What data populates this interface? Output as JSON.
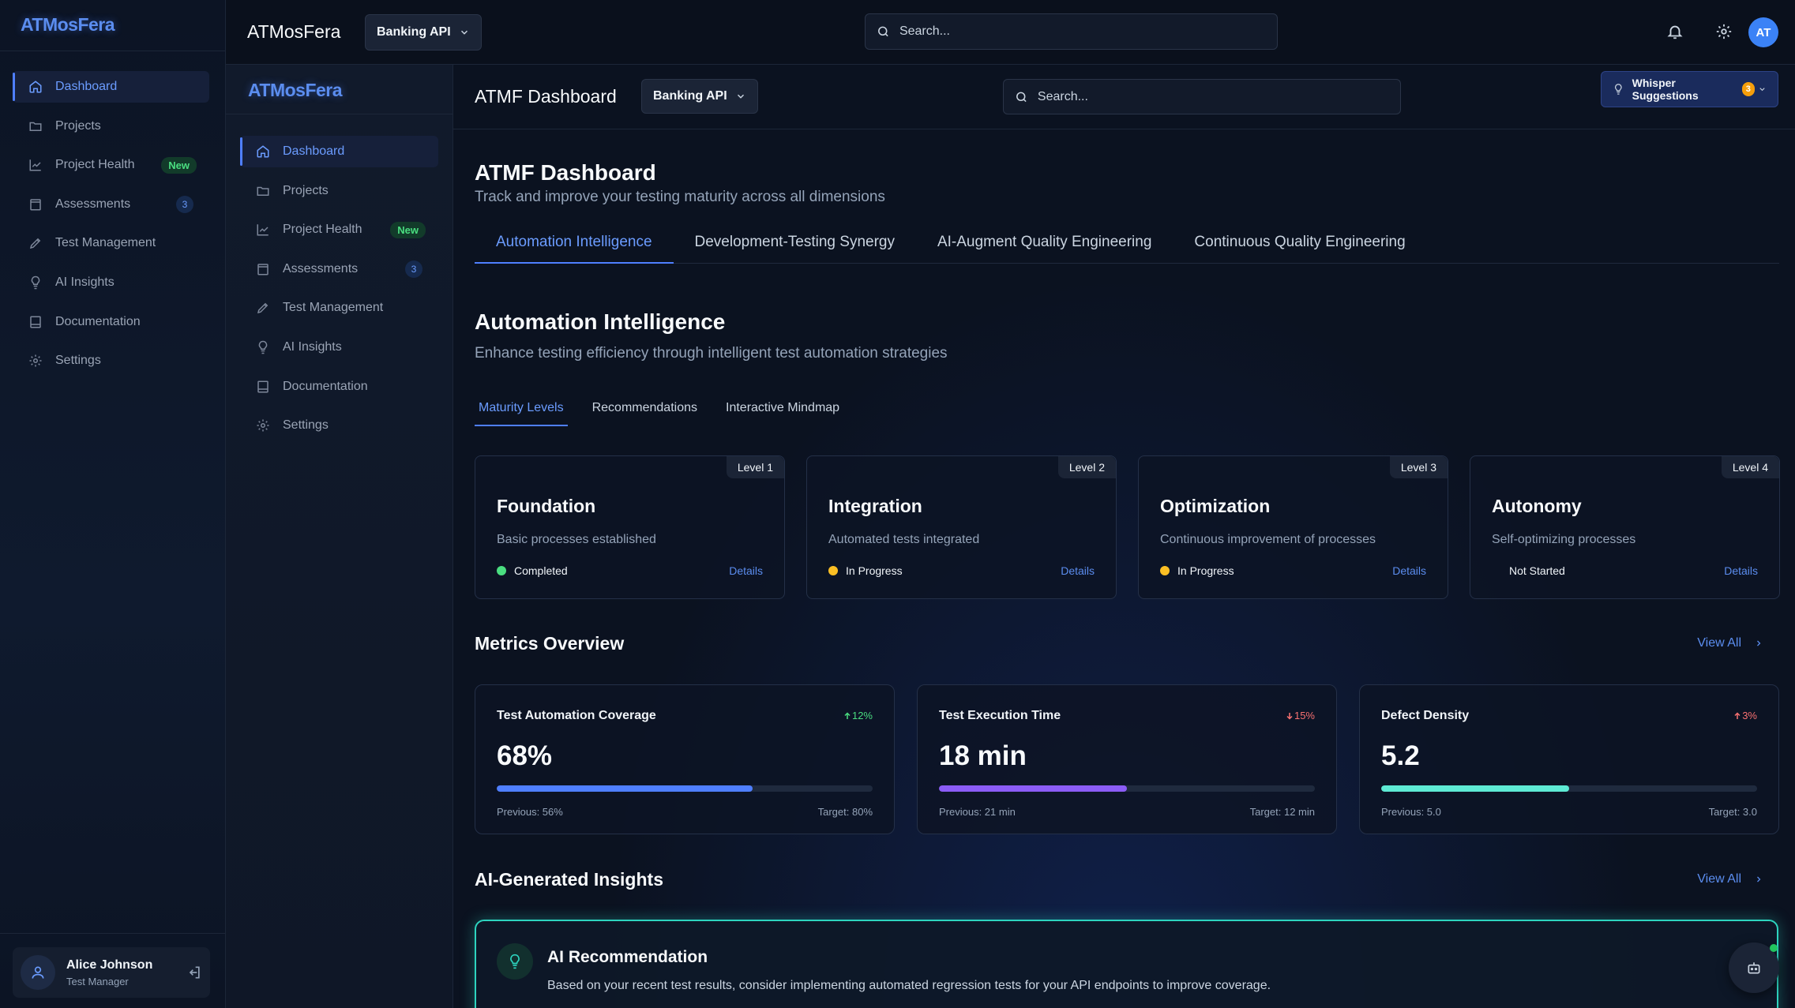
{
  "brand": {
    "logo_text": "ATMosFera",
    "accent": "#5b8def"
  },
  "sidebar": {
    "items": [
      {
        "label": "Dashboard",
        "icon": "home-icon",
        "active": true
      },
      {
        "label": "Projects",
        "icon": "folder-icon"
      },
      {
        "label": "Project Health",
        "icon": "chart-line-icon",
        "badge": "New"
      },
      {
        "label": "Assessments",
        "icon": "clipboard-icon",
        "count": "3"
      },
      {
        "label": "Test Management",
        "icon": "pencil-icon"
      },
      {
        "label": "AI Insights",
        "icon": "lightbulb-icon"
      },
      {
        "label": "Documentation",
        "icon": "book-icon"
      },
      {
        "label": "Settings",
        "icon": "gear-icon"
      }
    ]
  },
  "user": {
    "name": "Alice Johnson",
    "role": "Test Manager"
  },
  "topbar": {
    "app_title": "ATMosFera",
    "project": "Banking API",
    "search_placeholder": "Search...",
    "avatar_initials": "AT"
  },
  "main": {
    "header_title": "ATMF Dashboard",
    "project": "Banking API",
    "search_placeholder": "Search...",
    "whisper_label": "Whisper Suggestions",
    "whisper_count": "3",
    "page_title": "ATMF Dashboard",
    "page_subtitle": "Track and improve your testing maturity across all dimensions",
    "tabs": [
      {
        "label": "Automation Intelligence",
        "active": true
      },
      {
        "label": "Development-Testing Synergy"
      },
      {
        "label": "AI-Augment Quality Engineering"
      },
      {
        "label": "Continuous Quality Engineering"
      }
    ],
    "section": {
      "title": "Automation Intelligence",
      "subtitle": "Enhance testing efficiency through intelligent test automation strategies"
    },
    "subtabs": [
      {
        "label": "Maturity Levels",
        "active": true
      },
      {
        "label": "Recommendations"
      },
      {
        "label": "Interactive Mindmap"
      }
    ],
    "levels": [
      {
        "tag": "Level 1",
        "name": "Foundation",
        "desc": "Basic processes established",
        "status": "Completed",
        "status_color": "#4ade80",
        "details": "Details"
      },
      {
        "tag": "Level 2",
        "name": "Integration",
        "desc": "Automated tests integrated",
        "status": "In Progress",
        "status_color": "#fbbf24",
        "details": "Details"
      },
      {
        "tag": "Level 3",
        "name": "Optimization",
        "desc": "Continuous improvement of processes",
        "status": "In Progress",
        "status_color": "#fbbf24",
        "details": "Details"
      },
      {
        "tag": "Level 4",
        "name": "Autonomy",
        "desc": "Self-optimizing processes",
        "status": "Not Started",
        "status_color": "",
        "details": "Details"
      }
    ],
    "metrics_title": "Metrics Overview",
    "view_all": "View All",
    "metrics": [
      {
        "name": "Test Automation Coverage",
        "delta": "12%",
        "delta_dir": "up",
        "delta_color": "#4ade80",
        "value": "68%",
        "progress": 0.68,
        "bar_color": "#4f7fff",
        "previous": "Previous: 56%",
        "target": "Target: 80%"
      },
      {
        "name": "Test Execution Time",
        "delta": "15%",
        "delta_dir": "down",
        "delta_color": "#f87171",
        "value": "18 min",
        "progress": 0.5,
        "bar_color": "#8b5cf6",
        "previous": "Previous: 21 min",
        "target": "Target: 12 min"
      },
      {
        "name": "Defect Density",
        "delta": "3%",
        "delta_dir": "up",
        "delta_color": "#f87171",
        "value": "5.2",
        "progress": 0.5,
        "bar_color": "#5eead4",
        "previous": "Previous: 5.0",
        "target": "Target: 3.0"
      }
    ],
    "insights_title": "AI-Generated Insights",
    "insights_view_all": "View All",
    "ai_card": {
      "title": "AI Recommendation",
      "text": "Based on your recent test results, consider implementing automated regression tests for your API endpoints to improve coverage."
    }
  }
}
